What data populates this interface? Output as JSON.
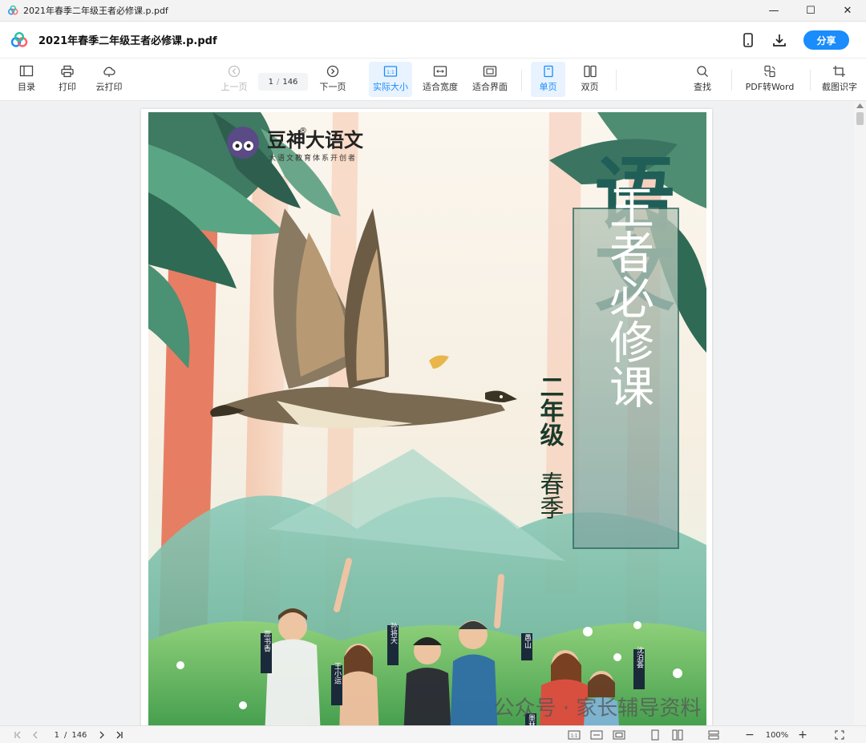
{
  "window": {
    "title": "2021年春季二年级王者必修课.p.pdf",
    "minimize": "—",
    "maximize": "☐",
    "close": "✕"
  },
  "header": {
    "doc_title": "2021年春季二年级王者必修课.p.pdf",
    "share_label": "分享",
    "accent": "#1a8cfb"
  },
  "toolbar": {
    "toc": "目录",
    "print": "打印",
    "cloud_print": "云打印",
    "prev_page": "上一页",
    "current_page": "1",
    "separator": "/",
    "total_pages": "146",
    "next_page": "下一页",
    "actual_size": "实际大小",
    "fit_width": "适合宽度",
    "fit_page": "适合界面",
    "single_page": "单页",
    "double_page": "双页",
    "find": "查找",
    "pdf_to_word": "PDF转Word",
    "screenshot_ocr": "截图识字",
    "actual_size_badge": "1:1"
  },
  "cover": {
    "brand": "豆神大语文",
    "brand_reg": "®",
    "brand_sub": "大语文教育体系开创者",
    "title_big": "语文",
    "title_main": "王者必修课",
    "grade": "二年级",
    "season": "春季",
    "names": [
      "蕊书香",
      "孙将天",
      "王小运",
      "愚山",
      "沈泊荟",
      "墨林"
    ],
    "watermark": "公众号 · 家长辅导资料"
  },
  "statusbar": {
    "current_page": "1",
    "separator": "/",
    "total_pages": "146",
    "ratio_badge": "1:1",
    "zoom": "100%",
    "zoom_out": "−",
    "zoom_in": "+"
  }
}
